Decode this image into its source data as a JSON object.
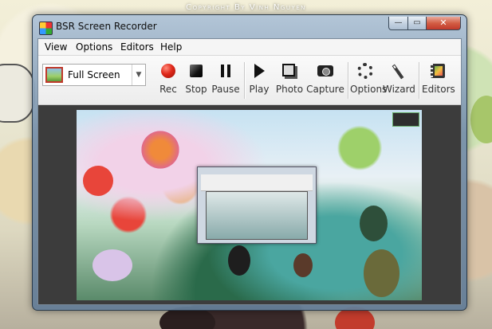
{
  "desktop": {
    "copyright": "Copyright By Vinh Nguyen"
  },
  "window": {
    "title": "BSR Screen Recorder",
    "controls": {
      "minimize_icon": "minimize-icon",
      "maximize_icon": "maximize-icon",
      "close_icon": "close-icon",
      "close_glyph": "✕",
      "minimize_glyph": "—",
      "maximize_glyph": "▭"
    }
  },
  "menu": {
    "items": [
      "View",
      "Options",
      "Editors",
      "Help"
    ]
  },
  "toolbar": {
    "mode_select": {
      "value": "Full Screen"
    },
    "buttons": [
      {
        "label": "Rec",
        "icon": "record-icon"
      },
      {
        "label": "Stop",
        "icon": "stop-icon"
      },
      {
        "label": "Pause",
        "icon": "pause-icon"
      },
      {
        "label": "Play",
        "icon": "play-icon"
      },
      {
        "label": "Photo",
        "icon": "photo-icon"
      },
      {
        "label": "Capture",
        "icon": "camera-icon"
      },
      {
        "label": "Options",
        "icon": "gear-icon"
      },
      {
        "label": "Wizard",
        "icon": "wand-icon"
      },
      {
        "label": "Editors",
        "icon": "film-icon"
      }
    ]
  },
  "colors": {
    "record": "#e0281a",
    "close_button": "#c0392b"
  }
}
